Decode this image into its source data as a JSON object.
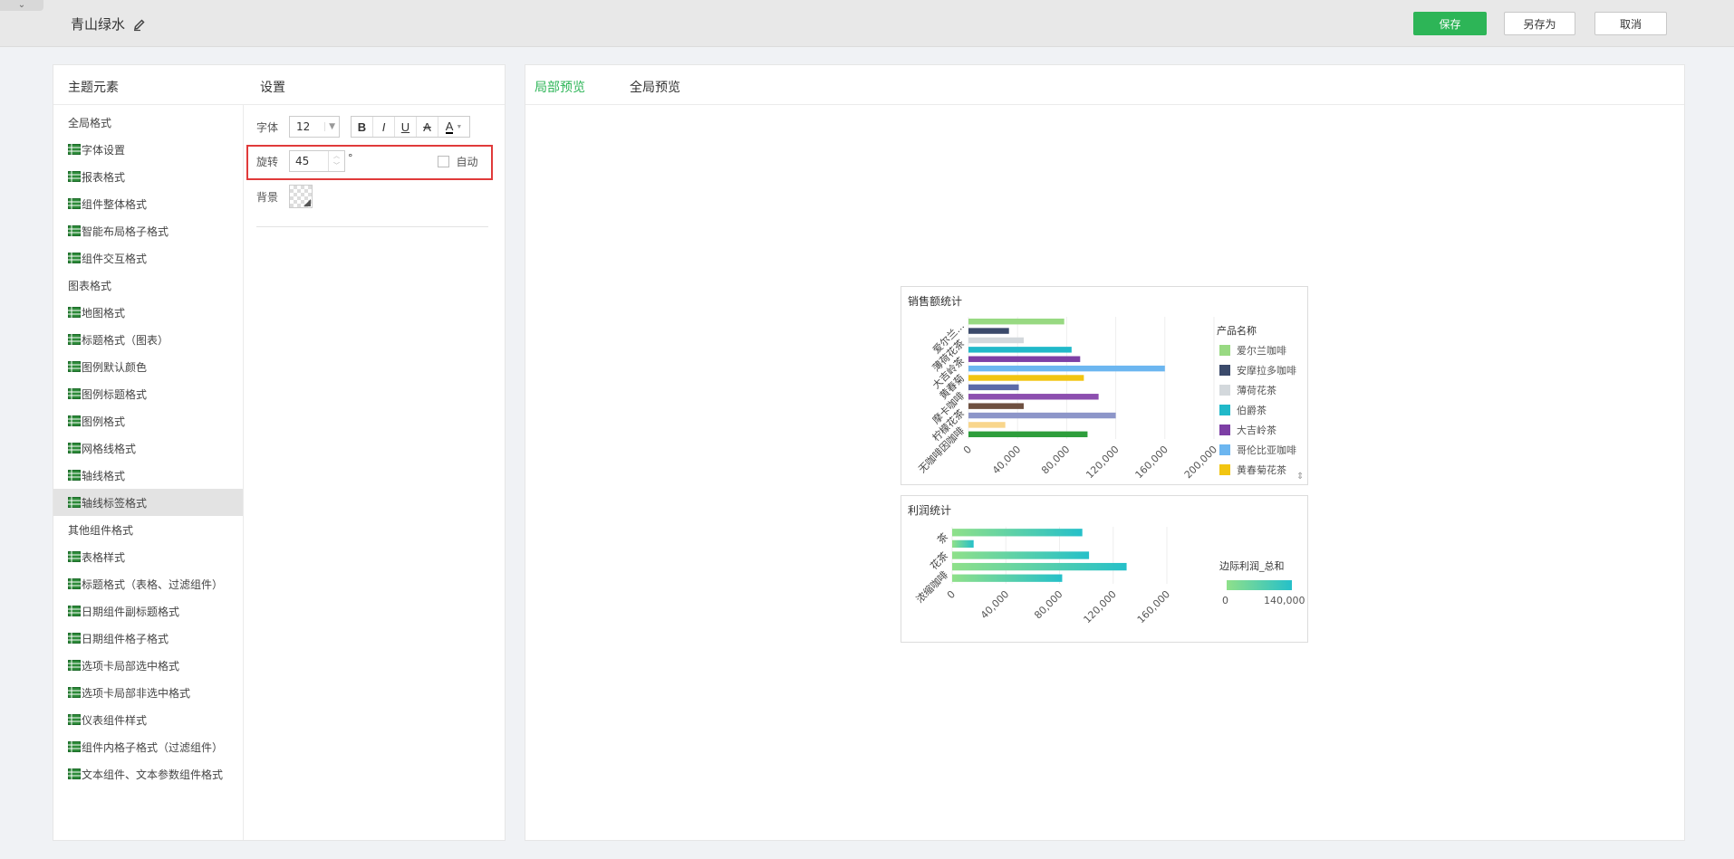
{
  "header": {
    "title": "青山绿水",
    "save_label": "保存",
    "save_as_label": "另存为",
    "cancel_label": "取消"
  },
  "left_panel": {
    "tree_title": "主题元素",
    "settings_title": "设置",
    "tree_items": [
      {
        "label": "全局格式",
        "group": true
      },
      {
        "label": "字体设置",
        "group": false
      },
      {
        "label": "报表格式",
        "group": false
      },
      {
        "label": "组件整体格式",
        "group": false
      },
      {
        "label": "智能布局格子格式",
        "group": false
      },
      {
        "label": "组件交互格式",
        "group": false
      },
      {
        "label": "图表格式",
        "group": true
      },
      {
        "label": "地图格式",
        "group": false
      },
      {
        "label": "标题格式（图表）",
        "group": false
      },
      {
        "label": "图例默认颜色",
        "group": false
      },
      {
        "label": "图例标题格式",
        "group": false
      },
      {
        "label": "图例格式",
        "group": false
      },
      {
        "label": "网格线格式",
        "group": false
      },
      {
        "label": "轴线格式",
        "group": false
      },
      {
        "label": "轴线标签格式",
        "group": false,
        "active": true
      },
      {
        "label": "其他组件格式",
        "group": true
      },
      {
        "label": "表格样式",
        "group": false
      },
      {
        "label": "标题格式（表格、过滤组件）",
        "group": false
      },
      {
        "label": "日期组件副标题格式",
        "group": false
      },
      {
        "label": "日期组件格子格式",
        "group": false
      },
      {
        "label": "选项卡局部选中格式",
        "group": false
      },
      {
        "label": "选项卡局部非选中格式",
        "group": false
      },
      {
        "label": "仪表组件样式",
        "group": false
      },
      {
        "label": "组件内格子格式（过滤组件）",
        "group": false
      },
      {
        "label": "文本组件、文本参数组件格式",
        "group": false
      }
    ],
    "settings": {
      "font_label": "字体",
      "font_size": "12",
      "style_buttons": [
        "B",
        "I",
        "U",
        "A",
        "A"
      ],
      "rotation_label": "旋转",
      "rotation_value": "45",
      "rotation_unit": "°",
      "auto_label": "自动",
      "background_label": "背景"
    }
  },
  "right_panel": {
    "tabs": [
      {
        "label": "局部预览",
        "active": true
      },
      {
        "label": "全局预览",
        "active": false
      }
    ]
  },
  "colors": {
    "accent": "#2db557",
    "highlight_border": "#e03a3a"
  },
  "chart_data": [
    {
      "type": "bar",
      "orientation": "horizontal",
      "title": "销售额统计",
      "categories": [
        "爱尔兰...",
        "薄荷花茶",
        "大吉岭茶",
        "黄春菊",
        "摩卡咖啡",
        "柠檬花茶",
        "无咖啡因咖啡"
      ],
      "bars": [
        {
          "value": 78000,
          "color": "#98d982"
        },
        {
          "value": 33000,
          "color": "#3b4a6b"
        },
        {
          "value": 45000,
          "color": "#d3d8dc"
        },
        {
          "value": 84000,
          "color": "#21b9c9"
        },
        {
          "value": 91000,
          "color": "#7d3fa5"
        },
        {
          "value": 160000,
          "color": "#6cb6f0"
        },
        {
          "value": 94000,
          "color": "#f2c511"
        },
        {
          "value": 41000,
          "color": "#5c6aa8"
        },
        {
          "value": 106000,
          "color": "#8c4faf"
        },
        {
          "value": 45000,
          "color": "#6e5040"
        },
        {
          "value": 120000,
          "color": "#8d96c9"
        },
        {
          "value": 30000,
          "color": "#f9d68b"
        },
        {
          "value": 97000,
          "color": "#2e9e3c"
        }
      ],
      "x_ticks": [
        "0",
        "40,000",
        "80,000",
        "120,000",
        "160,000",
        "200,000"
      ],
      "xlim": [
        0,
        200000
      ],
      "legend_title": "产品名称",
      "legend": [
        {
          "name": "爱尔兰咖啡",
          "color": "#98d982"
        },
        {
          "name": "安摩拉多咖啡",
          "color": "#3b4a6b"
        },
        {
          "name": "薄荷花茶",
          "color": "#d3d8dc"
        },
        {
          "name": "伯爵茶",
          "color": "#21b9c9"
        },
        {
          "name": "大吉岭茶",
          "color": "#7d3fa5"
        },
        {
          "name": "哥伦比亚咖啡",
          "color": "#6cb6f0"
        },
        {
          "name": "黄春菊花茶",
          "color": "#f2c511"
        }
      ],
      "legend_placement": "right",
      "grid": true
    },
    {
      "type": "bar",
      "orientation": "horizontal",
      "title": "利润统计",
      "categories": [
        "茶",
        "花茶",
        "浓缩咖啡"
      ],
      "bars": [
        {
          "value": 97000
        },
        {
          "value": 16000
        },
        {
          "value": 102000
        },
        {
          "value": 130000
        },
        {
          "value": 82000
        }
      ],
      "x_ticks": [
        "0",
        "40,000",
        "80,000",
        "120,000",
        "160,000"
      ],
      "xlim": [
        0,
        160000
      ],
      "legend_title": "边际利润_总和",
      "legend_range": [
        "0",
        "140,000"
      ],
      "gradient_colors": [
        "#8fe08a",
        "#25c0c9"
      ],
      "grid": true
    }
  ]
}
